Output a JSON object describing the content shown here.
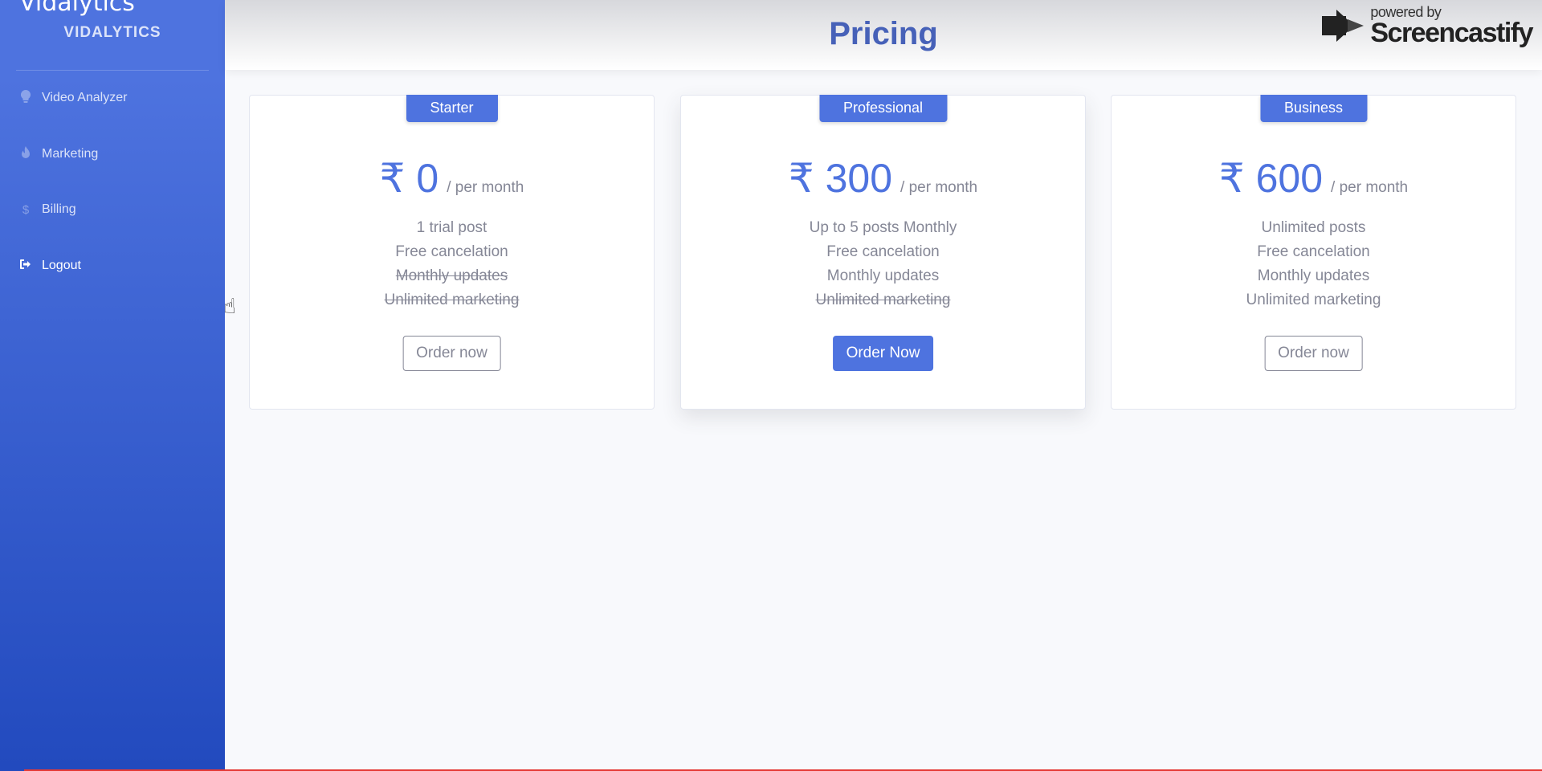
{
  "sidebar": {
    "overlay_title": "Vidalytics",
    "brand": "VIDALYTICS",
    "items": [
      {
        "label": "Video Analyzer",
        "icon": "lightbulb-icon"
      },
      {
        "label": "Marketing",
        "icon": "fire-icon"
      },
      {
        "label": "Billing",
        "icon": "dollar-icon"
      },
      {
        "label": "Logout",
        "icon": "sign-out-icon"
      }
    ]
  },
  "header": {
    "title": "Pricing",
    "watermark_small": "powered by",
    "watermark_big": "Screencastify"
  },
  "plans": [
    {
      "name": "Starter",
      "currency": "₹",
      "amount": "0",
      "period": "/ per month",
      "features": [
        {
          "text": "1 trial post",
          "included": true
        },
        {
          "text": "Free cancelation",
          "included": true
        },
        {
          "text": "Monthly updates",
          "included": false
        },
        {
          "text": "Unlimited marketing",
          "included": false
        }
      ],
      "button": "Order now"
    },
    {
      "name": "Professional",
      "currency": "₹",
      "amount": "300",
      "period": "/ per month",
      "features": [
        {
          "text": "Up to 5 posts Monthly",
          "included": true
        },
        {
          "text": "Free cancelation",
          "included": true
        },
        {
          "text": "Monthly updates",
          "included": true
        },
        {
          "text": "Unlimited marketing",
          "included": false
        }
      ],
      "button": "Order Now"
    },
    {
      "name": "Business",
      "currency": "₹",
      "amount": "600",
      "period": "/ per month",
      "features": [
        {
          "text": "Unlimited posts",
          "included": true
        },
        {
          "text": "Free cancelation",
          "included": true
        },
        {
          "text": "Monthly updates",
          "included": true
        },
        {
          "text": "Unlimited marketing",
          "included": true
        }
      ],
      "button": "Order now"
    }
  ],
  "colors": {
    "primary": "#4e73df",
    "title": "#4661b8",
    "muted_text": "#858796",
    "background": "#f8f9fc"
  }
}
